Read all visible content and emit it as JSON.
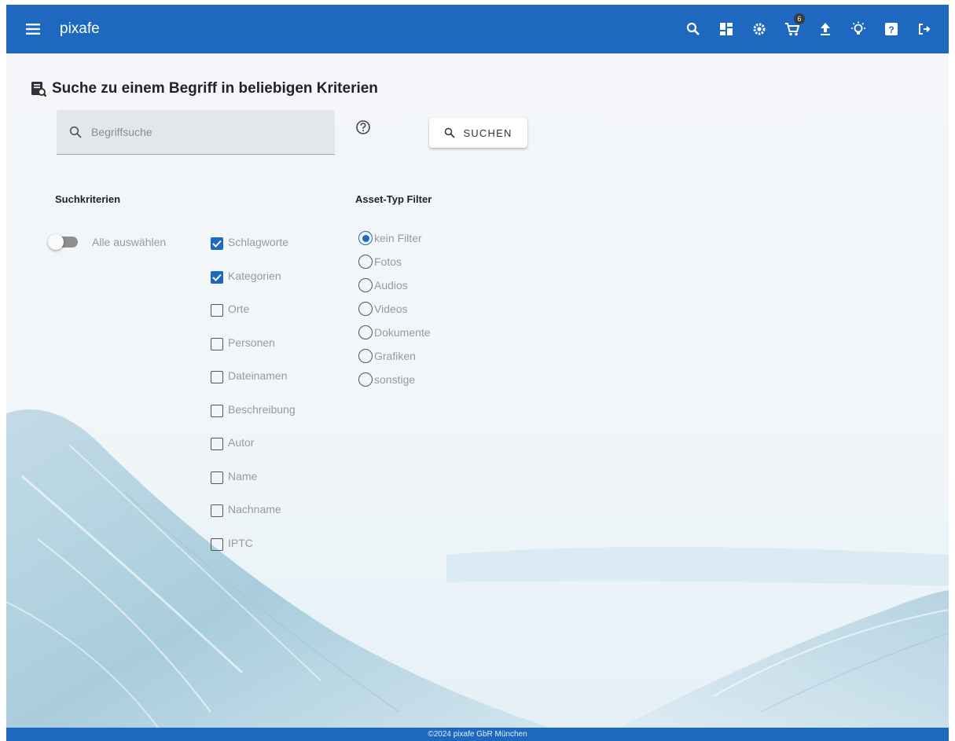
{
  "app": {
    "title": "pixafe",
    "menu_icon": "hamburger-menu-icon"
  },
  "topbar": {
    "actions": [
      {
        "name": "search",
        "icon": "search-icon"
      },
      {
        "name": "dashboard",
        "icon": "dashboard-icon"
      },
      {
        "name": "settings",
        "icon": "gear-icon"
      },
      {
        "name": "cart",
        "icon": "cart-icon",
        "badge": "6"
      },
      {
        "name": "upload",
        "icon": "upload-icon"
      },
      {
        "name": "theme",
        "icon": "lightbulb-icon"
      },
      {
        "name": "help",
        "icon": "help-icon"
      },
      {
        "name": "logout",
        "icon": "logout-icon"
      }
    ]
  },
  "page": {
    "title": "Suche zu einem Begriff in beliebigen Kriterien",
    "title_icon": "search-document-icon"
  },
  "search": {
    "placeholder": "Begriffsuche",
    "value": "",
    "button_label": "SUCHEN"
  },
  "criteria": {
    "heading": "Suchkriterien",
    "select_all_label": "Alle auswählen",
    "select_all_on": false,
    "items": [
      {
        "label": "Schlagworte",
        "checked": true
      },
      {
        "label": "Kategorien",
        "checked": true
      },
      {
        "label": "Orte",
        "checked": false
      },
      {
        "label": "Personen",
        "checked": false
      },
      {
        "label": "Dateinamen",
        "checked": false
      },
      {
        "label": "Beschreibung",
        "checked": false
      },
      {
        "label": "Autor",
        "checked": false
      },
      {
        "label": "Name",
        "checked": false
      },
      {
        "label": "Nachname",
        "checked": false
      },
      {
        "label": "IPTC",
        "checked": false
      }
    ]
  },
  "asset_filter": {
    "heading": "Asset-Typ Filter",
    "selected": "kein Filter",
    "options": [
      "kein Filter",
      "Fotos",
      "Audios",
      "Videos",
      "Dokumente",
      "Grafiken",
      "sonstige"
    ]
  },
  "footer": {
    "text": "©2024 pixafe GbR München"
  },
  "colors": {
    "primary": "#1e68c0",
    "muted_text": "#9a9a9a"
  }
}
